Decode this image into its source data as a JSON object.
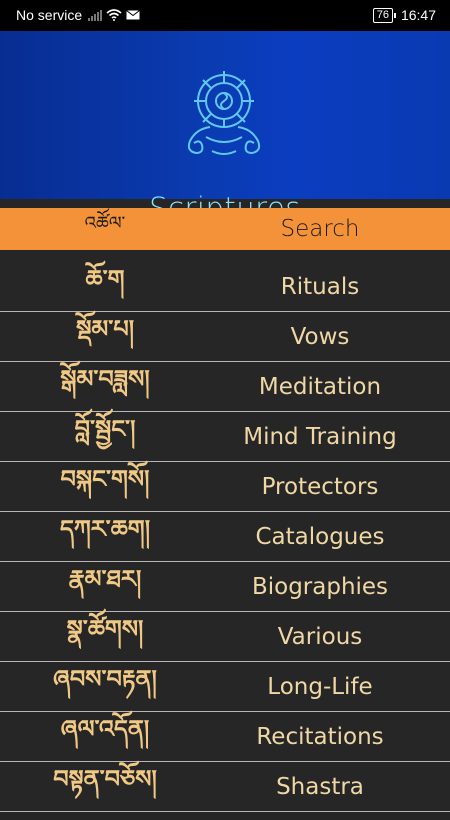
{
  "status_bar": {
    "carrier": "No service",
    "battery": "76",
    "time": "16:47"
  },
  "header": {
    "title": "Scriptures",
    "logo_icon": "dharma-wheel-logo-icon"
  },
  "search": {
    "tibetan_label": "འཚོལ་",
    "label": "Search"
  },
  "categories": [
    {
      "tibetan": "ཆོ་ག",
      "label": "Rituals"
    },
    {
      "tibetan": "སྡོམ་པ།",
      "label": "Vows"
    },
    {
      "tibetan": "སྒོམ་བཟླས།",
      "label": "Meditation"
    },
    {
      "tibetan": "བློ་སྦྱོང་།",
      "label": "Mind Training"
    },
    {
      "tibetan": "བསྐང་གསོ།",
      "label": "Protectors"
    },
    {
      "tibetan": "དཀར་ཆག།",
      "label": "Catalogues"
    },
    {
      "tibetan": "རྣམ་ཐར།",
      "label": "Biographies"
    },
    {
      "tibetan": "སྣ་ཚོགས།",
      "label": "Various"
    },
    {
      "tibetan": "ཞབས་བརྟན།",
      "label": "Long-Life"
    },
    {
      "tibetan": "ཞལ་འདོན།",
      "label": "Recitations"
    },
    {
      "tibetan": "བསྟན་བཅོས།",
      "label": "Shastra"
    }
  ],
  "colors": {
    "banner": "#0a3bb0",
    "search_bar": "#f4923a",
    "list_bg": "#262626",
    "category_text": "#efd8a6",
    "title_text": "#8ee4ff"
  }
}
